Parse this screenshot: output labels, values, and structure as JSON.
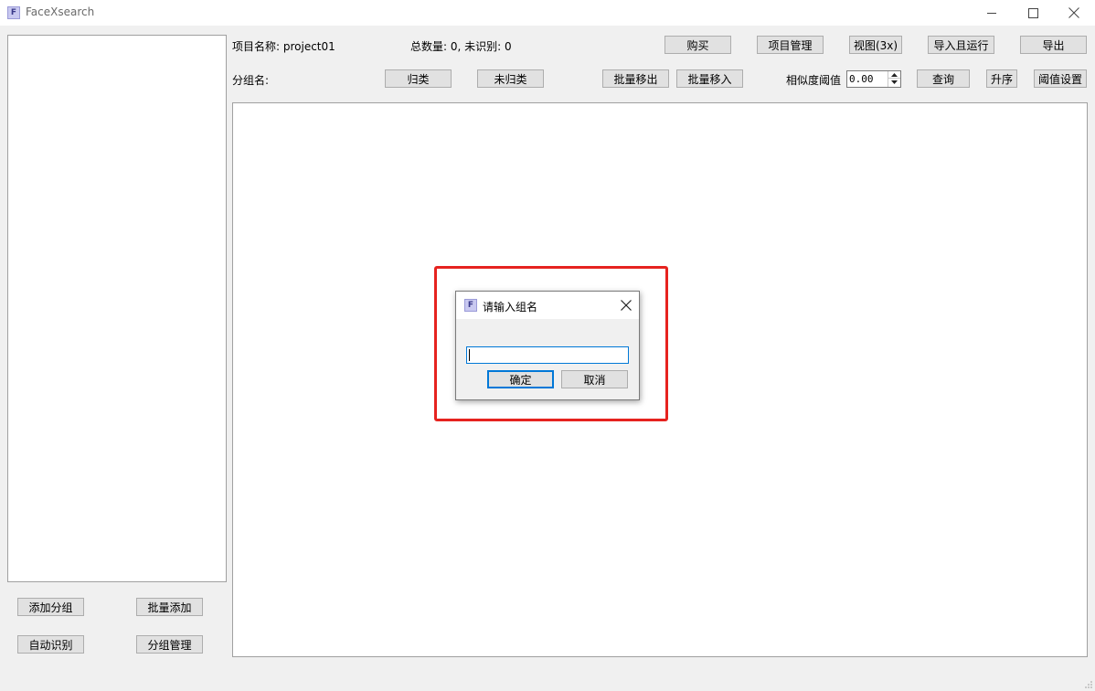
{
  "window": {
    "title": "FaceXsearch",
    "icon_letter": "F"
  },
  "header": {
    "project_label": "项目名称: project01",
    "count_label": "总数量: 0, 未识别: 0",
    "group_label": "分组名:",
    "threshold_label": "相似度阈值",
    "threshold_value": "0.00"
  },
  "toolbar": {
    "buy": "购买",
    "project_manage": "项目管理",
    "view": "视图(3x)",
    "import_run": "导入且运行",
    "export": "导出",
    "classify": "归类",
    "unclassified": "未归类",
    "batch_move_out": "批量移出",
    "batch_move_in": "批量移入",
    "query": "查询",
    "ascending": "升序",
    "threshold_settings": "阈值设置"
  },
  "sidebar": {
    "add_group": "添加分组",
    "batch_add": "批量添加",
    "auto_recognize": "自动识别",
    "group_manage": "分组管理"
  },
  "dialog": {
    "title": "请输入组名",
    "icon_letter": "F",
    "input_value": "",
    "ok": "确定",
    "cancel": "取消"
  },
  "colors": {
    "highlight": "#e6231f",
    "focus": "#0078d7"
  }
}
